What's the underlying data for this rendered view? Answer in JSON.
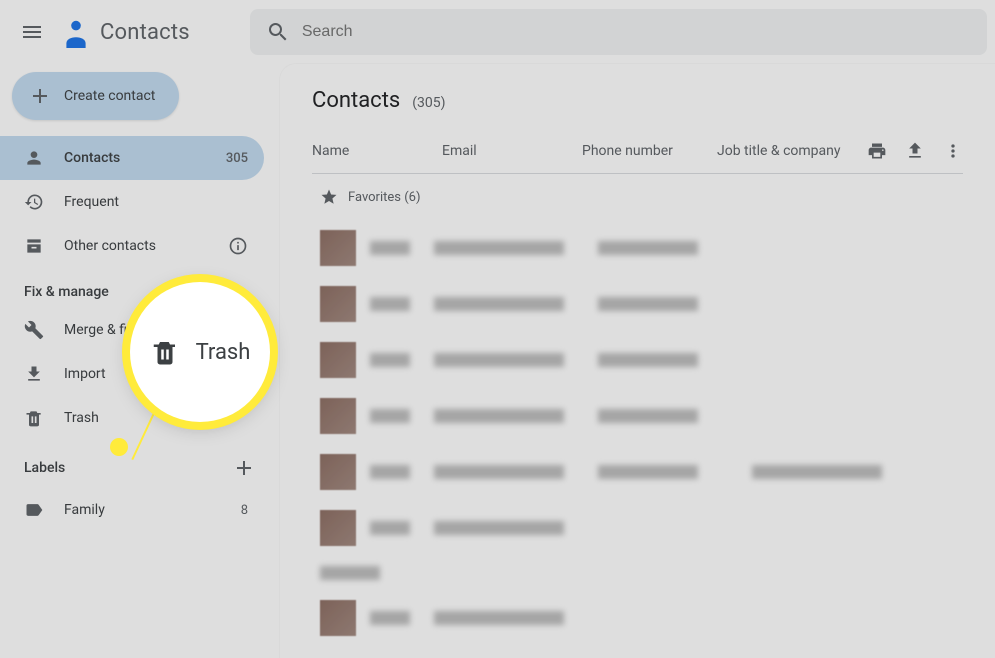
{
  "header": {
    "app_title": "Contacts",
    "search_placeholder": "Search"
  },
  "sidebar": {
    "create_label": "Create contact",
    "nav": {
      "contacts": {
        "label": "Contacts",
        "count": "305"
      },
      "frequent": {
        "label": "Frequent"
      },
      "other": {
        "label": "Other contacts"
      }
    },
    "fix_manage": {
      "header": "Fix & manage",
      "merge_fix": "Merge & fix",
      "import": "Import",
      "trash": "Trash"
    },
    "labels": {
      "header": "Labels",
      "items": [
        {
          "label": "Family",
          "count": "8"
        }
      ]
    }
  },
  "main": {
    "title": "Contacts",
    "count": "(305)",
    "columns": {
      "name": "Name",
      "email": "Email",
      "phone": "Phone number",
      "job": "Job title & company"
    },
    "favorites_label": "Favorites (6)"
  },
  "callout": {
    "label": "Trash"
  }
}
